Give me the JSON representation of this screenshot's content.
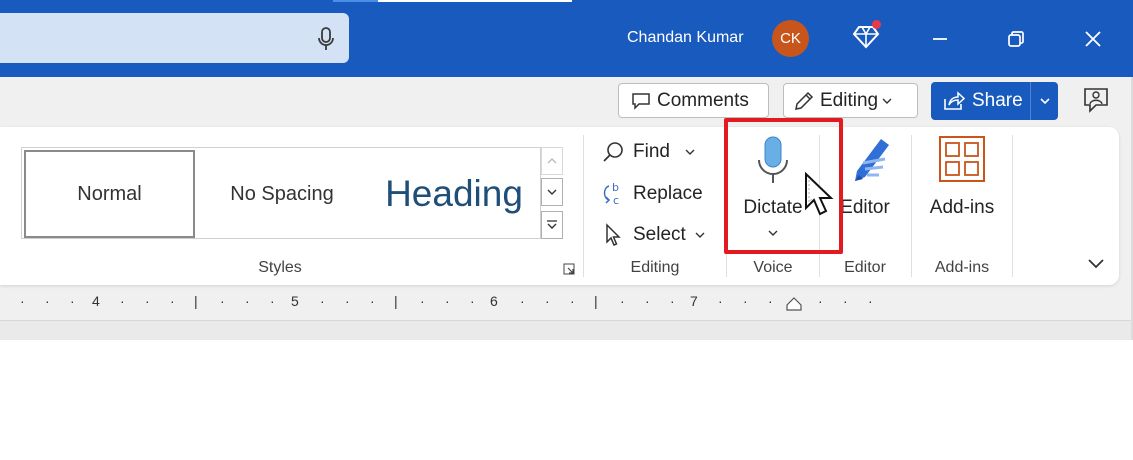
{
  "window": {
    "user_name": "Chandan Kumar",
    "avatar_initials": "CK",
    "accent_color": "#185abd",
    "avatar_color": "#c8561c"
  },
  "toolbar": {
    "comments_label": "Comments",
    "editing_label": "Editing",
    "share_label": "Share"
  },
  "styles": {
    "items": [
      "Normal",
      "No Spacing",
      "Heading"
    ],
    "group_label": "Styles"
  },
  "editing": {
    "find_label": "Find",
    "replace_label": "Replace",
    "select_label": "Select",
    "group_label": "Editing"
  },
  "voice": {
    "dictate_label": "Dictate",
    "group_label": "Voice"
  },
  "editor": {
    "button_label": "Editor",
    "group_label": "Editor"
  },
  "addins": {
    "button_label": "Add-ins",
    "group_label": "Add-ins"
  },
  "ruler": {
    "numbers": [
      "4",
      "5",
      "6",
      "7"
    ]
  },
  "annotation": {
    "highlight_color": "#e21b23"
  }
}
